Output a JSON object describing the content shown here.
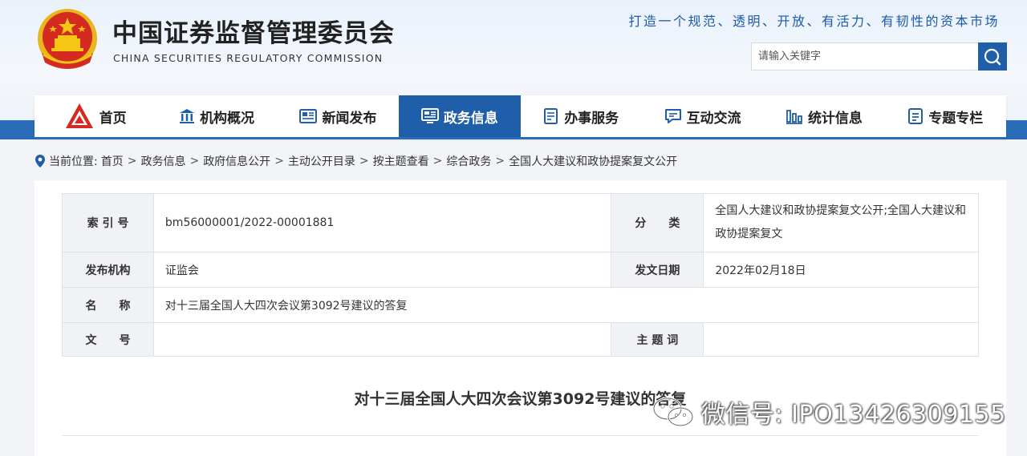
{
  "header": {
    "org_name_cn": "中国证券监督管理委员会",
    "org_name_en": "CHINA SECURITIES REGULATORY COMMISSION",
    "slogan": "打造一个规范、透明、开放、有活力、有韧性的资本市场",
    "search": {
      "placeholder": "请输入关键字"
    }
  },
  "nav": {
    "items": [
      {
        "label": "首页",
        "icon": "csrc-logo-icon"
      },
      {
        "label": "机构概况",
        "icon": "building-icon"
      },
      {
        "label": "新闻发布",
        "icon": "newspaper-icon"
      },
      {
        "label": "政务信息",
        "icon": "monitor-icon",
        "active": true
      },
      {
        "label": "办事服务",
        "icon": "document-list-icon"
      },
      {
        "label": "互动交流",
        "icon": "chat-icon"
      },
      {
        "label": "统计信息",
        "icon": "bar-chart-icon"
      },
      {
        "label": "专题专栏",
        "icon": "notepad-icon"
      }
    ]
  },
  "breadcrumb": {
    "prefix": "当前位置:",
    "items": [
      "首页",
      "政务信息",
      "政府信息公开",
      "主动公开目录",
      "按主题查看",
      "综合政务",
      "全国人大建议和政协提案复文公开"
    ]
  },
  "meta_table": {
    "index_label": "索 引 号",
    "index_value": "bm56000001/2022-00001881",
    "category_label": "分　　类",
    "category_value": "全国人大建议和政协提案复文公开;全国人大建议和政协提案复文",
    "publisher_label": "发布机构",
    "publisher_value": "证监会",
    "date_label": "发文日期",
    "date_value": "2022年02月18日",
    "name_label": "名　　称",
    "name_value": "对十三届全国人大四次会议第3092号建议的答复",
    "docno_label": "文　　号",
    "docno_value": "",
    "keywords_label": "主 题 词",
    "keywords_value": ""
  },
  "article": {
    "title": "对十三届全国人大四次会议第3092号建议的答复"
  },
  "watermark": {
    "text": "微信号: IPO13426309155"
  },
  "colors": {
    "primary_blue": "#1f5ea8",
    "band_blue": "#2b6cb6",
    "emblem_red": "#d42a1f",
    "emblem_gold": "#f5c518"
  }
}
